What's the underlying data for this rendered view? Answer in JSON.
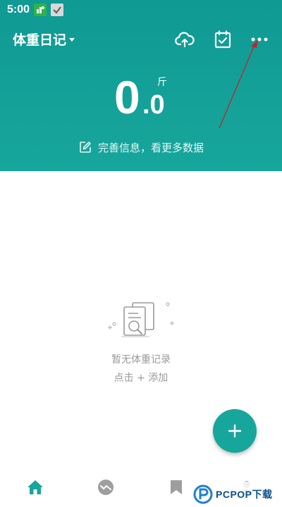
{
  "status_bar": {
    "time": "5:00",
    "icons": [
      "app-notification-icon",
      "check-notification-icon"
    ]
  },
  "header": {
    "title": "体重日记",
    "actions": [
      "cloud-sync-icon",
      "calendar-check-icon",
      "more-options-icon"
    ],
    "weight_integer": "0",
    "weight_decimal": ".0",
    "weight_unit": "斤",
    "info_link": "完善信息，看更多数据"
  },
  "empty_state": {
    "title": "暂无体重记录",
    "hint": "点击 + 添加"
  },
  "fab": {
    "icon": "plus-icon"
  },
  "bottom_nav": {
    "items": [
      "home-icon",
      "trend-icon",
      "bookmark-icon",
      "profile-icon"
    ],
    "active": "home-icon"
  },
  "watermark": {
    "text": "PCPOP下载"
  },
  "colors": {
    "primary": "#17a69c",
    "header_top": "#0f9a93",
    "annotation_arrow": "#c0262c",
    "muted_text": "#9a9a9a",
    "nav_inactive": "#9e9e9e"
  }
}
